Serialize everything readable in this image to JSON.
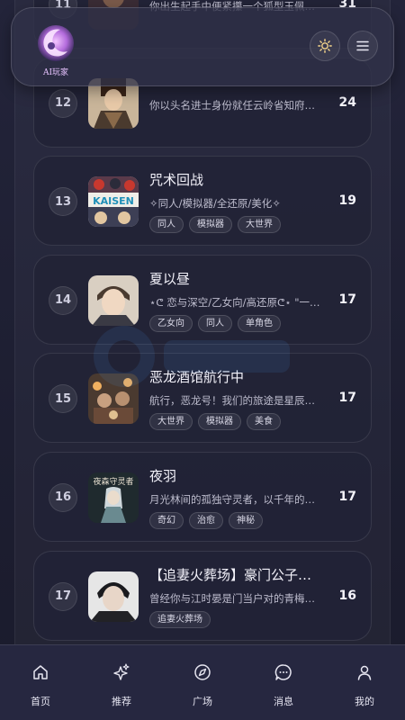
{
  "header": {
    "logo_text": "AI玩家",
    "theme_icon": "sun-icon",
    "menu_icon": "menu-icon"
  },
  "list": [
    {
      "rank": "11",
      "title": "",
      "desc": "你出生起手中便紧攥一个狐型玉佩…",
      "tags": [],
      "count": "31"
    },
    {
      "rank": "12",
      "title": "",
      "desc": "你以头名进士身份就任云岭省知府…",
      "tags": [],
      "count": "24"
    },
    {
      "rank": "13",
      "title": "咒术回战",
      "desc": "✧同人/模拟器/全还原/美化✧",
      "tags": [
        "同人",
        "模拟器",
        "大世界"
      ],
      "count": "19"
    },
    {
      "rank": "14",
      "title": "夏以昼",
      "desc": "⋆ᕦ 恋与深空/乙女向/高还原ᕦ⋆ \"一…",
      "tags": [
        "乙女向",
        "同人",
        "单角色"
      ],
      "count": "17"
    },
    {
      "rank": "15",
      "title": "恶龙酒馆航行中",
      "desc": "航行，恶龙号！我们的旅途是星辰…",
      "tags": [
        "大世界",
        "模拟器",
        "美食"
      ],
      "count": "17"
    },
    {
      "rank": "16",
      "title": "夜羽",
      "desc": "月光林间的孤独守灵者，以千年的…",
      "tags": [
        "奇幻",
        "治愈",
        "神秘"
      ],
      "count": "17"
    },
    {
      "rank": "17",
      "title": "【追妻火葬场】豪门公子…",
      "desc": "曾经你与江时晏是门当户对的青梅…",
      "tags": [
        "追妻火葬场"
      ],
      "count": "16"
    },
    {
      "rank": "",
      "title": "",
      "desc": "",
      "tags": [],
      "count": ""
    }
  ],
  "thumb_text": {
    "r13": "KAISEN",
    "r16": "夜森守灵者"
  },
  "nav": [
    {
      "label": "首页",
      "icon": "home-icon"
    },
    {
      "label": "推荐",
      "icon": "sparkle-icon"
    },
    {
      "label": "广场",
      "icon": "compass-icon"
    },
    {
      "label": "消息",
      "icon": "chat-icon"
    },
    {
      "label": "我的",
      "icon": "user-icon"
    }
  ],
  "colors": {
    "background": "#1b1c2e",
    "card": "#222336",
    "accent": "#e7c3ff",
    "sun": "#f2d38a"
  }
}
